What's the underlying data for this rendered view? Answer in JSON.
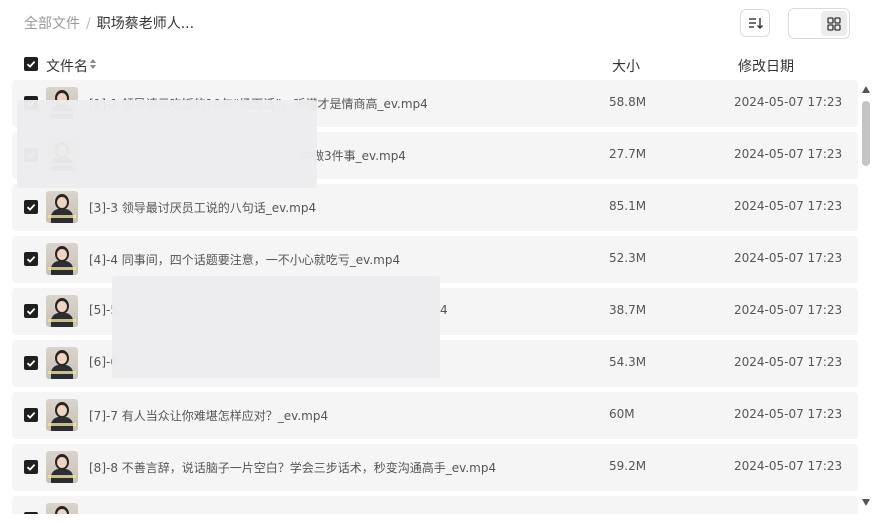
{
  "breadcrumb": {
    "root": "全部文件",
    "separator": "/",
    "current": "职场蔡老师人..."
  },
  "toolbar": {
    "sort_icon": "sort-icon",
    "list_view_icon": "list-view-icon",
    "grid_view_icon": "grid-view-icon"
  },
  "columns": {
    "name": "文件名",
    "size": "大小",
    "date": "修改日期"
  },
  "files": [
    {
      "name": "[1]-1 领导请示吃饭的10句“场面话”，听懂才是情商高_ev.mp4",
      "visible_name": "[1]-1 领导请示吃饭的10句“场面话”，听懂才是情商高_ev.mp4",
      "size": "58.8M",
      "date": "2024-05-07 17:23"
    },
    {
      "name": "你做3件事_ev.mp4",
      "visible_name": "你做3件事_ev.mp4",
      "size": "27.7M",
      "date": "2024-05-07 17:23"
    },
    {
      "name": "[3]-3 领导最讨厌员工说的八句话_ev.mp4",
      "visible_name": "[3]-3 领导最讨厌员工说的八句话_ev.mp4",
      "size": "85.1M",
      "date": "2024-05-07 17:23"
    },
    {
      "name": "[4]-4 同事间，四个话题要注意，一不小心就吃亏_ev.mp4",
      "visible_name": "[4]-4 同事间，四个话题要注意，一不小心就吃亏_ev.mp4",
      "size": "52.3M",
      "date": "2024-05-07 17:23"
    },
    {
      "name": "[5]-5",
      "visible_name": "[5]-5",
      "tail": "4",
      "size": "38.7M",
      "date": "2024-05-07 17:23"
    },
    {
      "name": "[6]-6",
      "visible_name": "[6]-6",
      "size": "54.3M",
      "date": "2024-05-07 17:23"
    },
    {
      "name": "[7]-7 有人当众让你难堪怎样应对？_ev.mp4",
      "visible_name": "[7]-7 有人当众让你难堪怎样应对？_ev.mp4",
      "size": "60M",
      "date": "2024-05-07 17:23"
    },
    {
      "name": "[8]-8 不善言辞，说话脑子一片空白？学会三步话术，秒变沟通高手_ev.mp4",
      "visible_name": "[8]-8 不善言辞，说话脑子一片空白？学会三步话术，秒变沟通高手_ev.mp4",
      "size": "59.2M",
      "date": "2024-05-07 17:23"
    }
  ],
  "colors": {
    "row_bg": "#f5f5f5",
    "checkbox": "#1f1f1f",
    "text": "#555555"
  }
}
